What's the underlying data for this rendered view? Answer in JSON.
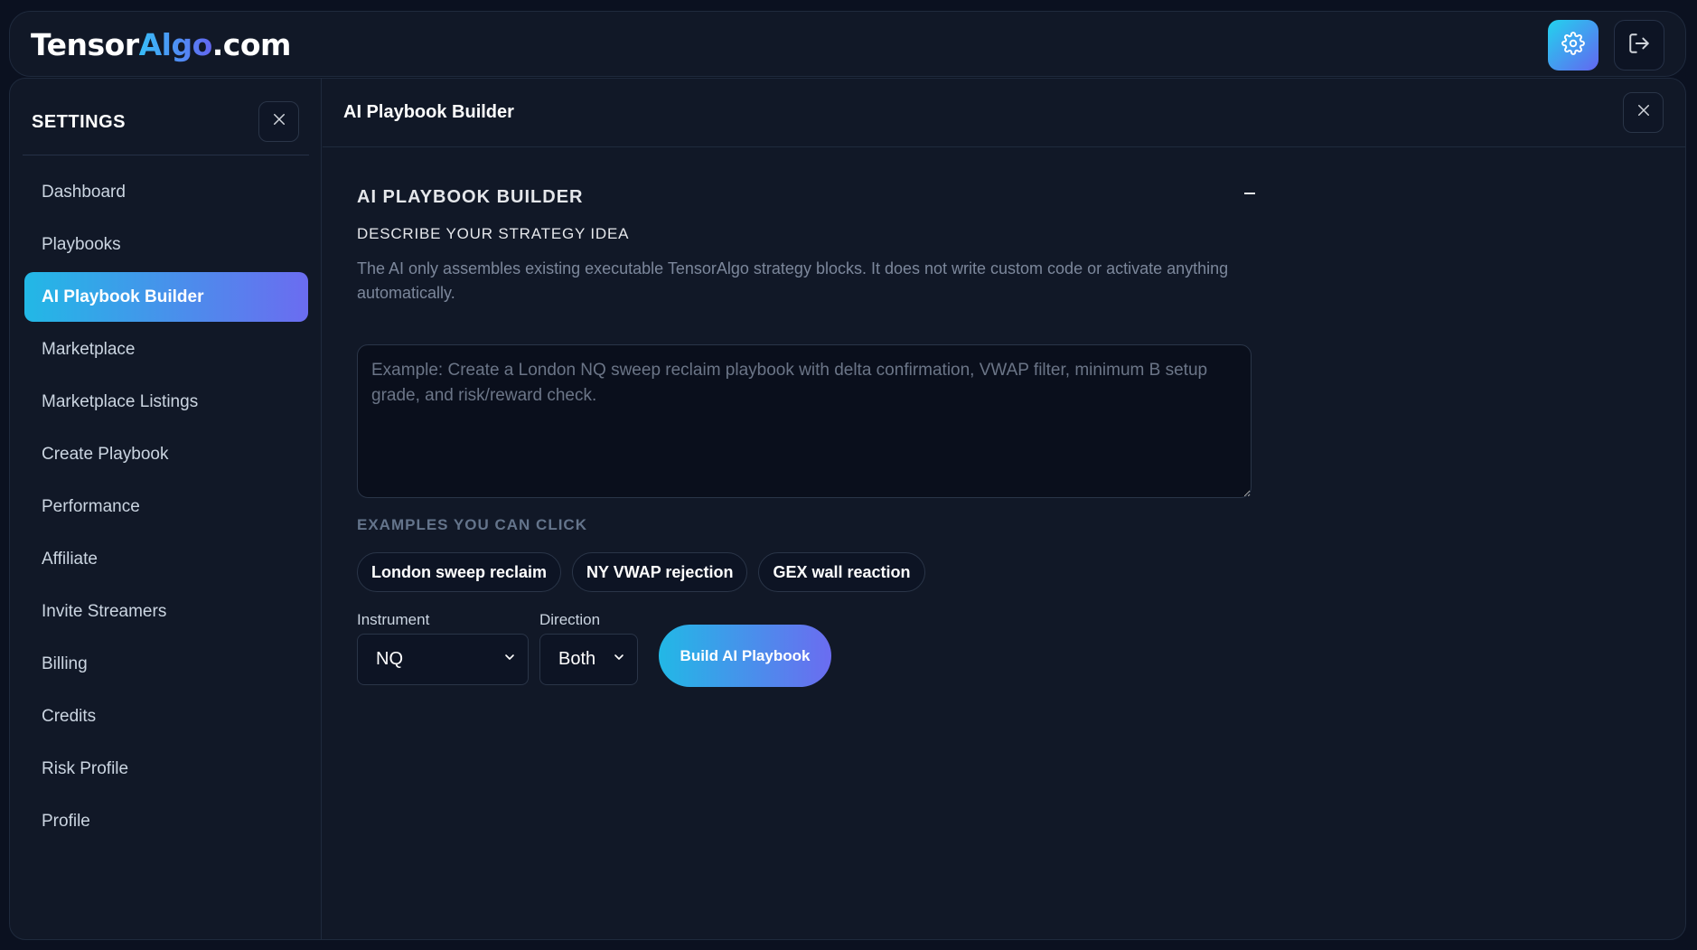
{
  "header": {
    "brand_prefix": "Tensor",
    "brand_accent": "Algo",
    "brand_suffix": ".com",
    "settings_icon": "gear-icon",
    "logout_icon": "logout-icon"
  },
  "sidebar": {
    "title": "SETTINGS",
    "items": [
      {
        "label": "Dashboard",
        "active": false
      },
      {
        "label": "Playbooks",
        "active": false
      },
      {
        "label": "AI Playbook Builder",
        "active": true
      },
      {
        "label": "Marketplace",
        "active": false
      },
      {
        "label": "Marketplace Listings",
        "active": false
      },
      {
        "label": "Create Playbook",
        "active": false
      },
      {
        "label": "Performance",
        "active": false
      },
      {
        "label": "Affiliate",
        "active": false
      },
      {
        "label": "Invite Streamers",
        "active": false
      },
      {
        "label": "Billing",
        "active": false
      },
      {
        "label": "Credits",
        "active": false
      },
      {
        "label": "Risk Profile",
        "active": false
      },
      {
        "label": "Profile",
        "active": false
      }
    ]
  },
  "main": {
    "title": "AI Playbook Builder",
    "section_title": "AI PLAYBOOK BUILDER",
    "collapse_symbol": "–",
    "describe_label": "DESCRIBE YOUR STRATEGY IDEA",
    "help_text": "The AI only assembles existing executable TensorAlgo strategy blocks. It does not write custom code or activate anything automatically.",
    "idea": {
      "value": "",
      "placeholder": "Example: Create a London NQ sweep reclaim playbook with delta confirmation, VWAP filter, minimum B setup grade, and risk/reward check."
    },
    "examples_label": "EXAMPLES YOU CAN CLICK",
    "examples": [
      "London sweep reclaim",
      "NY VWAP rejection",
      "GEX wall reaction"
    ],
    "instrument": {
      "label": "Instrument",
      "value": "NQ"
    },
    "direction": {
      "label": "Direction",
      "value": "Both"
    },
    "build_label": "Build AI Playbook"
  },
  "colors": {
    "accent_start": "#22b8e6",
    "accent_end": "#6b6cf0",
    "background": "#0b1120",
    "panel": "#111827"
  }
}
